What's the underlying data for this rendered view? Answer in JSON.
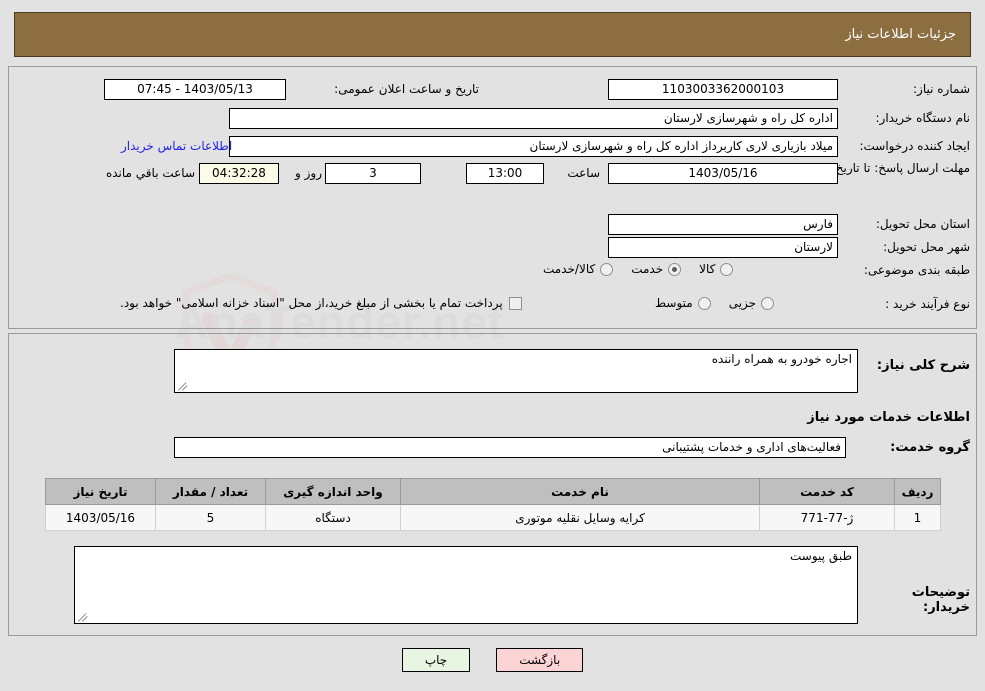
{
  "header": {
    "title": "جزئیات اطلاعات نیاز",
    "bg_color": "#8d6e41"
  },
  "form": {
    "need_number_label": "شماره نیاز:",
    "need_number_value": "1103003362000103",
    "publish_datetime_label": "تاریخ و ساعت اعلان عمومی:",
    "publish_datetime_value": "1403/05/13 - 07:45",
    "buyer_org_label": "نام دستگاه خریدار:",
    "buyer_org_value": "اداره کل راه و شهرسازی لارستان",
    "creator_label": "ایجاد کننده درخواست:",
    "creator_value": "میلاد بازیاری لاری کاربرداز اداره کل راه و شهرسازی لارستان",
    "contact_link": "اطلاعات تماس خریدار",
    "deadline_label": "مهلت ارسال پاسخ: تا تاریخ:",
    "deadline_date": "1403/05/16",
    "hour_label": "ساعت",
    "hour_value": "13:00",
    "days_value": "3",
    "and_label": "روز و",
    "countdown_value": "04:32:28",
    "remaining_label": "ساعت باقي مانده",
    "province_label": "استان محل تحویل:",
    "province_value": "فارس",
    "city_label": "شهر محل تحویل:",
    "city_value": "لارستان",
    "category_label": "طبقه بندی موضوعی:",
    "category_options": [
      {
        "label": "کالا",
        "selected": false
      },
      {
        "label": "خدمت",
        "selected": true
      },
      {
        "label": "کالا/خدمت",
        "selected": false
      }
    ],
    "process_label": "نوع فرآیند خرید :",
    "process_options": [
      {
        "label": "جزیی",
        "selected": false
      },
      {
        "label": "متوسط",
        "selected": false
      }
    ],
    "treasury_checkbox_label": "پرداخت تمام یا بخشی از مبلغ خرید،از محل \"اسناد خزانه اسلامی\" خواهد بود.",
    "treasury_checked": false
  },
  "details": {
    "need_description_label": "شرح کلی نیاز:",
    "need_description_value": "اجاره خودرو به همراه راننده",
    "services_heading": "اطلاعات خدمات مورد نیاز",
    "service_group_label": "گروه خدمت:",
    "service_group_value": "فعالیت‌های اداری و خدمات پشتیبانی",
    "buyer_note_label": "توضیحات خریدار:",
    "buyer_note_value": "طبق پیوست"
  },
  "table": {
    "columns": [
      "ردیف",
      "کد خدمت",
      "نام خدمت",
      "واحد اندازه گیری",
      "تعداد / مقدار",
      "تاریخ نیاز"
    ],
    "rows": [
      {
        "row_no": "1",
        "service_code": "ژ-77-771",
        "service_name": "کرایه وسایل نقلیه موتوری",
        "unit": "دستگاه",
        "quantity": "5",
        "need_date": "1403/05/16"
      }
    ]
  },
  "footer": {
    "print_label": "چاپ",
    "back_label": "بازگشت"
  },
  "watermark": {
    "text": "AnaTender.net"
  }
}
